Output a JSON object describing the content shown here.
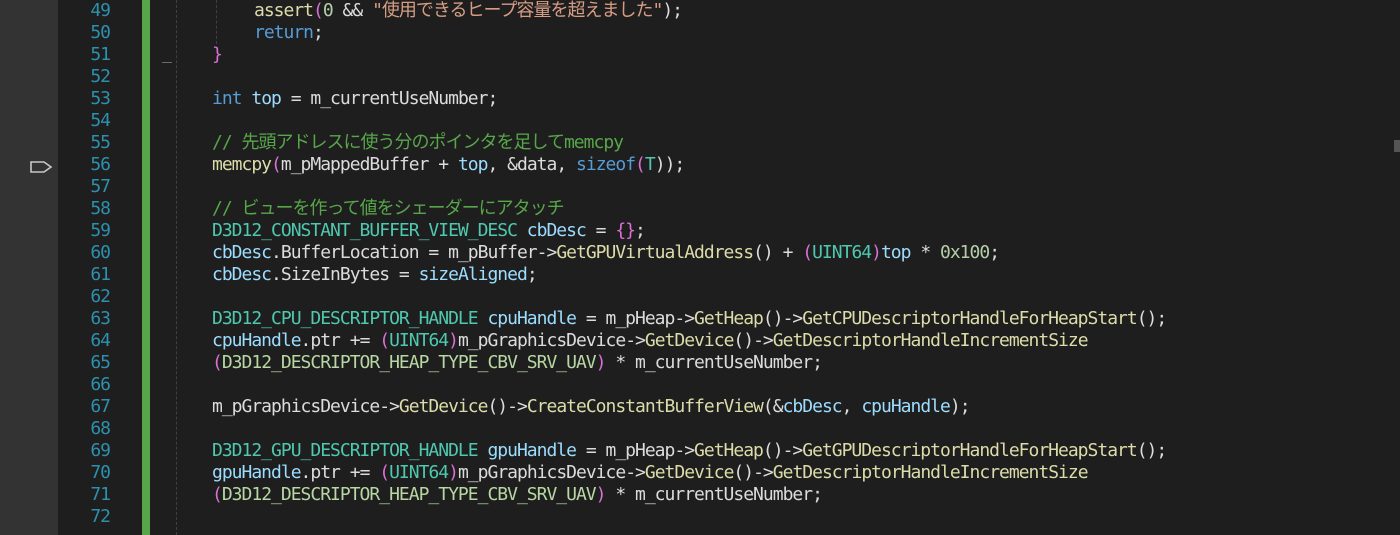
{
  "editor": {
    "language": "cpp",
    "current_line": "56",
    "colors": {
      "background": "#1e1e1e",
      "line_number": "#2b91af",
      "change_bar": "#57a64a",
      "keyword": "#569cd6",
      "type": "#4ec9b0",
      "function": "#dcdcaa",
      "variable": "#9cdcfe",
      "string": "#d69d85",
      "number": "#b5cea8",
      "comment": "#57a64a"
    },
    "line_numbers": [
      "49",
      "50",
      "51",
      "52",
      "53",
      "54",
      "55",
      "56",
      "57",
      "58",
      "59",
      "60",
      "61",
      "62",
      "63",
      "64",
      "65",
      "66",
      "67",
      "68",
      "69",
      "70",
      "71",
      "72"
    ],
    "lines": {
      "l49": {
        "kw1": "assert",
        "p1": "(",
        "n1": "0",
        "p2": " && ",
        "s1": "\"使用できるヒープ容量を超えました\"",
        "p3": ");"
      },
      "l50": {
        "kw1": "return",
        "p1": ";"
      },
      "l51": {
        "p1": "}"
      },
      "l53": {
        "kw1": "int",
        "v1": " top",
        "p1": " = m_currentUseNumber;"
      },
      "l55": {
        "c1": "// 先頭アドレスに使う分のポインタを足してmemcpy"
      },
      "l56": {
        "f1": "memcpy",
        "p1": "(",
        "p2": "m_pMappedBuffer + ",
        "v1": "top",
        "p3": ", &data, ",
        "k1": "sizeof",
        "p4": "(",
        "t1": "T",
        "p5": "));"
      },
      "l58": {
        "c1": "// ビューを作って値をシェーダーにアタッチ"
      },
      "l59": {
        "t1": "D3D12_CONSTANT_BUFFER_VIEW_DESC",
        "v1": " cbDesc",
        "p1": " = ",
        "b1": "{}",
        "p2": ";"
      },
      "l60": {
        "v1": "cbDesc",
        "p1": ".BufferLocation = m_pBuffer->",
        "f1": "GetGPUVirtualAddress",
        "p2": "() + ",
        "b1": "(",
        "t1": "UINT64",
        "b2": ")",
        "v2": "top",
        "p3": " * ",
        "n1": "0x100",
        "p4": ";"
      },
      "l61": {
        "v1": "cbDesc",
        "p1": ".SizeInBytes = ",
        "v2": "sizeAligned",
        "p2": ";"
      },
      "l63": {
        "t1": "D3D12_CPU_DESCRIPTOR_HANDLE",
        "v1": " cpuHandle",
        "p1": " = m_pHeap->",
        "f1": "GetHeap",
        "p2": "()->",
        "f2": "GetCPUDescriptorHandleForHeapStart",
        "p3": "();"
      },
      "l64": {
        "v1": "cpuHandle",
        "p1": ".ptr += ",
        "b1": "(",
        "t1": "UINT64",
        "b2": ")",
        "p2": "m_pGraphicsDevice->",
        "f1": "GetDevice",
        "p3": "()->",
        "f2": "GetDescriptorHandleIncrementSize"
      },
      "l65": {
        "b1": "(",
        "e1": "D3D12_DESCRIPTOR_HEAP_TYPE_CBV_SRV_UAV",
        "b2": ")",
        "p1": " * m_currentUseNumber;"
      },
      "l67": {
        "p1": "m_pGraphicsDevice->",
        "f1": "GetDevice",
        "p2": "()->",
        "f2": "CreateConstantBufferView",
        "p3": "(&",
        "v1": "cbDesc",
        "p4": ", ",
        "v2": "cpuHandle",
        "p5": ");"
      },
      "l69": {
        "t1": "D3D12_GPU_DESCRIPTOR_HANDLE",
        "v1": " gpuHandle",
        "p1": " = m_pHeap->",
        "f1": "GetHeap",
        "p2": "()->",
        "f2": "GetGPUDescriptorHandleForHeapStart",
        "p3": "();"
      },
      "l70": {
        "v1": "gpuHandle",
        "p1": ".ptr += ",
        "b1": "(",
        "t1": "UINT64",
        "b2": ")",
        "p2": "m_pGraphicsDevice->",
        "f1": "GetDevice",
        "p3": "()->",
        "f2": "GetDescriptorHandleIncrementSize"
      },
      "l71": {
        "b1": "(",
        "e1": "D3D12_DESCRIPTOR_HEAP_TYPE_CBV_SRV_UAV",
        "b2": ")",
        "p1": " * m_currentUseNumber;"
      }
    }
  }
}
